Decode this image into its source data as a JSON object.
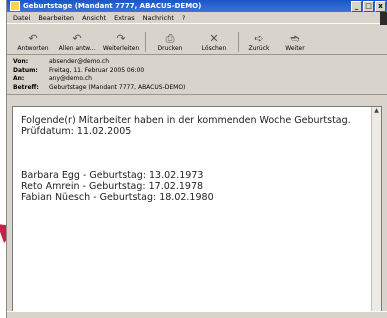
{
  "window": {
    "title": "Geburtstage (Mandant 7777, ABACUS-DEMO)",
    "controls": [
      "_",
      "□",
      "x"
    ]
  },
  "menubar": [
    "Datei",
    "Bearbeiten",
    "Ansicht",
    "Extras",
    "Nachricht",
    "?"
  ],
  "toolbar": [
    {
      "label": "Antworten",
      "icon": "reply-icon"
    },
    {
      "label": "Allen antw...",
      "icon": "reply-all-icon"
    },
    {
      "label": "Weiterleiten",
      "icon": "forward-icon"
    },
    {
      "label": "Drucken",
      "icon": "print-icon"
    },
    {
      "label": "Löschen",
      "icon": "delete-icon"
    },
    {
      "label": "Zurück",
      "icon": "back-icon"
    },
    {
      "label": "Weiter",
      "icon": "next-icon"
    }
  ],
  "header": {
    "from_label": "Von:",
    "from": "absender@demo.ch",
    "date_label": "Datum:",
    "date": "Freitag, 11. Februar 2005 06:00",
    "to_label": "An:",
    "to": "any@demo.ch",
    "subject_label": "Betreff:",
    "subject": "Geburtstage (Mandant 7777, ABACUS-DEMO)"
  },
  "body": {
    "line1": "Folgende(r) Mitarbeiter haben in der kommenden Woche Geburtstag.",
    "line2": "Prüfdatum: 11.02.2005",
    "entries": [
      "Barbara Egg - Geburtstag: 13.02.1973",
      "Reto Amrein - Geburtstag: 17.02.1978",
      "Fabian Nüesch - Geburtstag: 18.02.1980"
    ]
  },
  "colors": {
    "titlebar": "#1a56c8",
    "pointer": "#c8204a"
  }
}
